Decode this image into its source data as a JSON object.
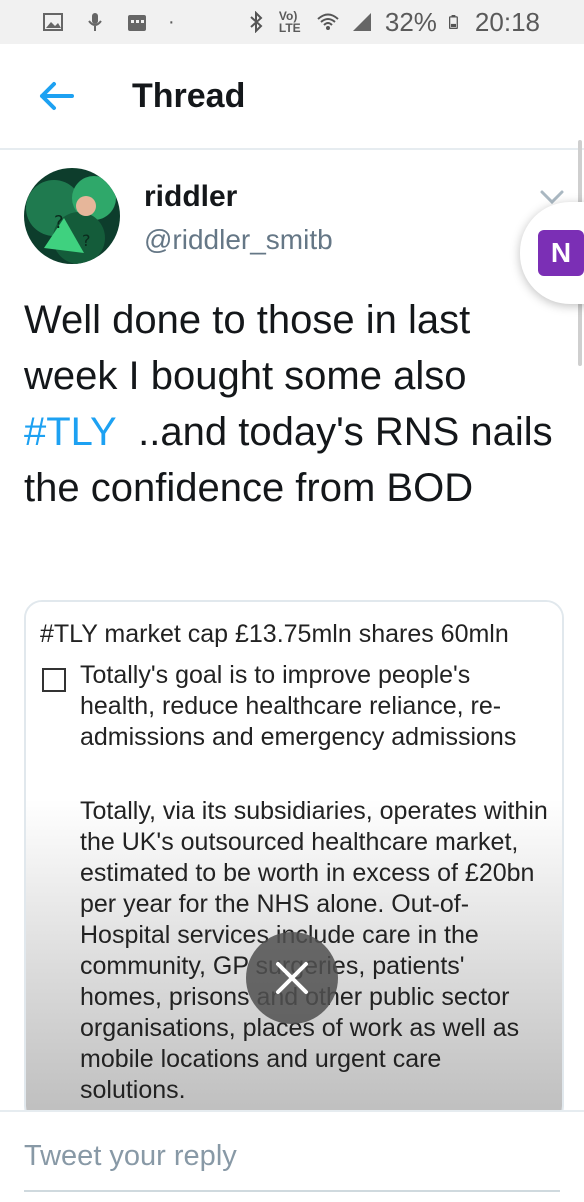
{
  "status_bar": {
    "battery": "32%",
    "time": "20:18",
    "network": "Vo) LTE",
    "dot": "·",
    "icons": [
      "image-icon",
      "mic-icon",
      "calendar-icon",
      "bluetooth-icon",
      "wifi-icon",
      "signal-icon",
      "battery-icon"
    ]
  },
  "header": {
    "title": "Thread",
    "back_icon": "arrow-left-icon"
  },
  "tweet": {
    "name": "riddler",
    "handle": "@riddler_smitb",
    "text_part1": "Well done to those in last week I bought some also ",
    "hashtag": "#TLY",
    "text_part2": "  ..and today's RNS nails the confidence from BOD"
  },
  "card": {
    "title": "#TLY market cap £13.75mln shares 60mln",
    "paragraph1": "Totally's goal is to improve people's health, reduce healthcare reliance, re-admissions and emergency admissions",
    "paragraph2": "Totally, via its subsidiaries, operates within the UK's outsourced healthcare market, estimated to be worth in excess of £20bn per year for the NHS alone. Out-of-Hospital services include care in the community, GP surgeries, patients' homes, prisons and other public sector organisations, places of work as well as mobile locations and urgent care solutions."
  },
  "onenote": {
    "label": "N"
  },
  "reply": {
    "placeholder": "Tweet your reply"
  },
  "colors": {
    "accent": "#1da1f2",
    "onenote": "#7b2fb5",
    "text": "#14171a",
    "muted": "#657786"
  }
}
